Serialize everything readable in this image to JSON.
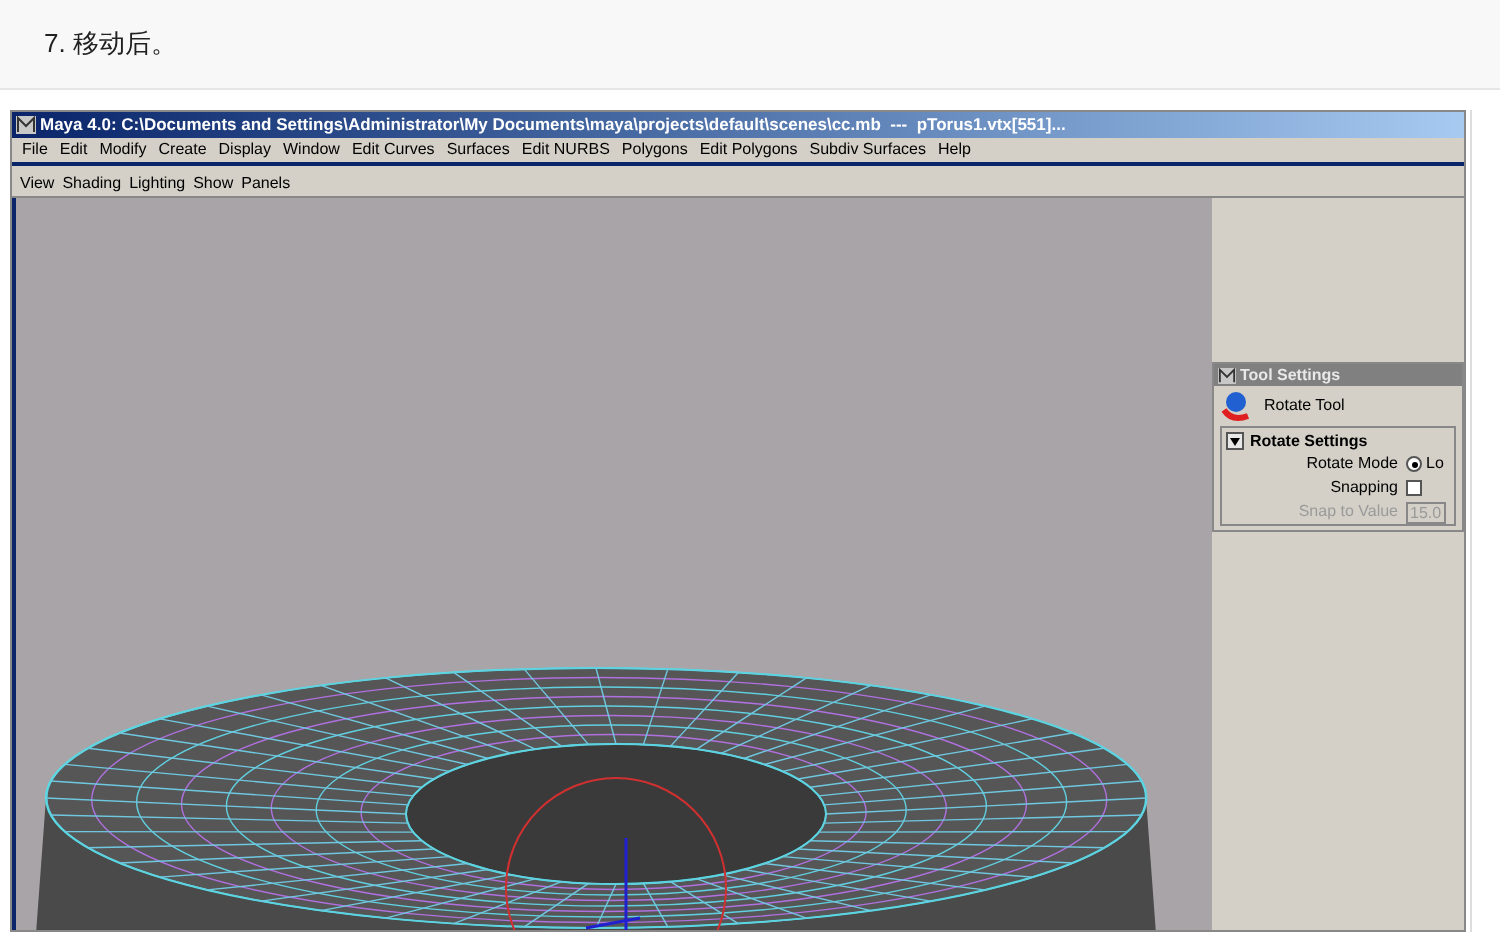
{
  "heading": "7. 移动后。",
  "window": {
    "title": "Maya 4.0: C:\\Documents and Settings\\Administrator\\My Documents\\maya\\projects\\default\\scenes\\cc.mb  ---  pTorus1.vtx[551]...",
    "menu": [
      "File",
      "Edit",
      "Modify",
      "Create",
      "Display",
      "Window",
      "Edit Curves",
      "Surfaces",
      "Edit NURBS",
      "Polygons",
      "Edit Polygons",
      "Subdiv Surfaces",
      "Help"
    ],
    "panel_menu": [
      "View",
      "Shading",
      "Lighting",
      "Show",
      "Panels"
    ]
  },
  "tool_settings": {
    "title": "Tool Settings",
    "tool": "Rotate Tool",
    "section": {
      "title": "Rotate Settings",
      "expanded": true
    },
    "rows": [
      {
        "kind": "radio",
        "label": "Rotate Mode",
        "option": "Lo",
        "selected": true
      },
      {
        "kind": "checkbox",
        "label": "Snapping",
        "checked": false
      },
      {
        "kind": "field",
        "label": "Snap to Value",
        "value": "15.0",
        "disabled": true
      }
    ]
  }
}
